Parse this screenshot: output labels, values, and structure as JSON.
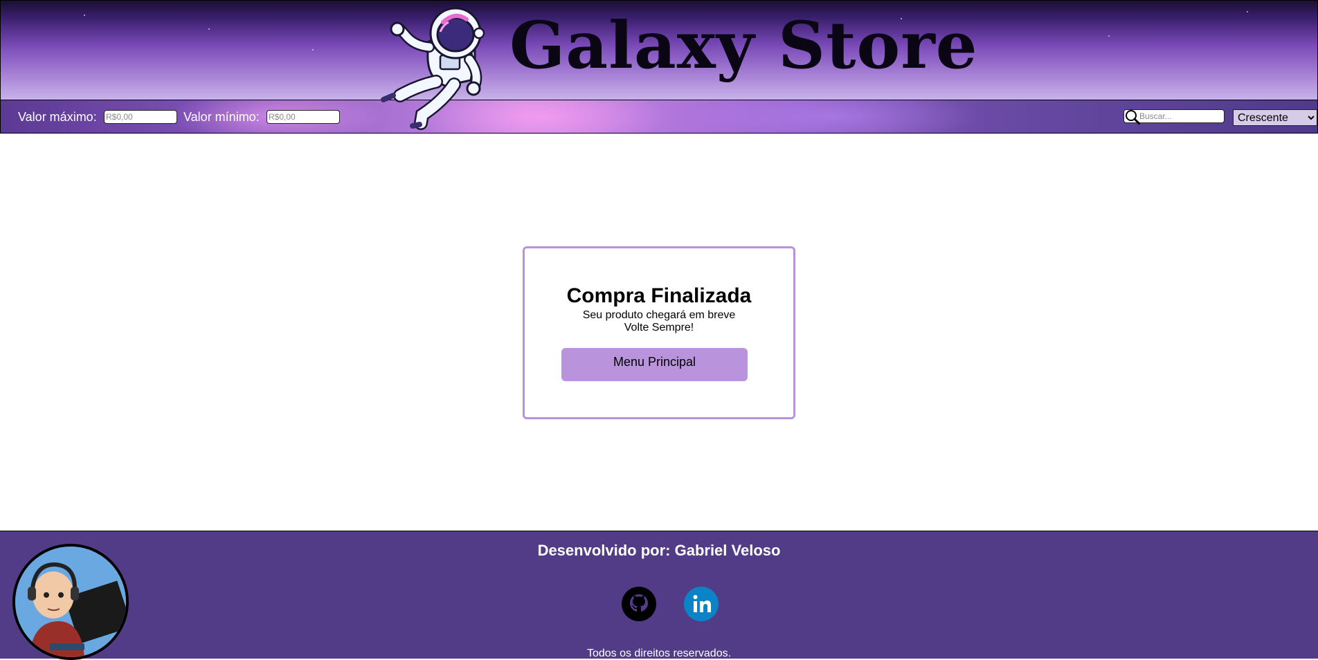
{
  "header": {
    "title": "Galaxy Store",
    "logo_icon": "astronaut-icon"
  },
  "filters": {
    "max_label": "Valor máximo:",
    "max_placeholder": "R$0,00",
    "min_label": "Valor mínimo:",
    "min_placeholder": "R$0,00",
    "search_placeholder": "Buscar...",
    "search_icon": "search-icon",
    "sort_selected": "Crescente"
  },
  "card": {
    "title": "Compra Finalizada",
    "line1": "Seu produto chegará em breve",
    "line2": "Volte Sempre!",
    "button_label": "Menu Principal",
    "accent_color": "#b693dc"
  },
  "footer": {
    "developer": "Desenvolvido por: Gabriel Veloso",
    "rights": "Todos os direitos reservados.",
    "background_color": "#523c88",
    "icons": [
      "avatar",
      "github-icon",
      "linkedin-icon"
    ]
  }
}
